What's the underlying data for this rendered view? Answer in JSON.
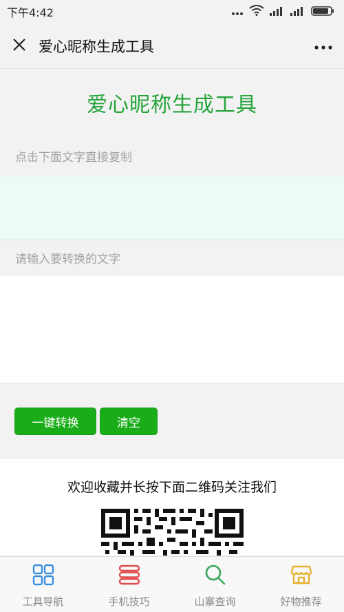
{
  "statusbar": {
    "time": "下午4:42",
    "icons": [
      "more-dots-icon",
      "wifi-icon",
      "signal-icon",
      "signal-icon",
      "battery-icon"
    ]
  },
  "header": {
    "title": "爱心昵称生成工具",
    "close_icon": "close-icon",
    "more_icon": "more-icon"
  },
  "main": {
    "heading": "爱心昵称生成工具",
    "output_label": "点击下面文字直接复制",
    "output_value": "",
    "input_label": "请输入要转换的文字",
    "input_value": "",
    "convert_button": "一键转换",
    "clear_button": "清空"
  },
  "promo": {
    "text": "欢迎收藏并长按下面二维码关注我们"
  },
  "tabbar": {
    "items": [
      {
        "label": "工具导航",
        "icon": "grid-icon",
        "color": "#3b8de0"
      },
      {
        "label": "手机技巧",
        "icon": "list-icon",
        "color": "#e04c4c"
      },
      {
        "label": "山寨查询",
        "icon": "search-icon",
        "color": "#3aa65a"
      },
      {
        "label": "好物推荐",
        "icon": "shop-icon",
        "color": "#e8b233"
      }
    ]
  },
  "colors": {
    "accent": "#1aad19",
    "heading": "#24a43a",
    "output_bg": "#eefaf6"
  }
}
